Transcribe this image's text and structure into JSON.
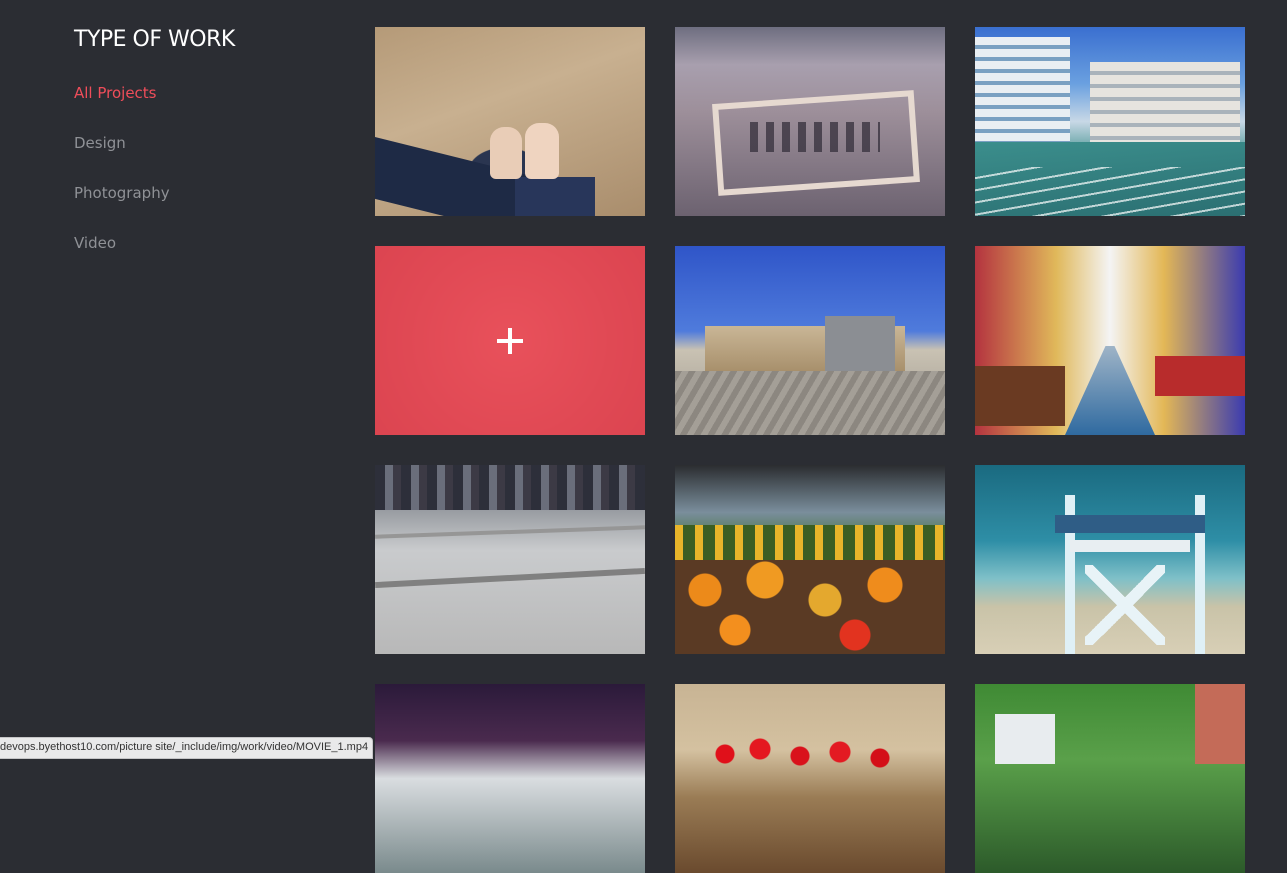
{
  "sidebar": {
    "title": "TYPE OF WORK",
    "filters": [
      {
        "label": "All Projects",
        "active": true
      },
      {
        "label": "Design",
        "active": false
      },
      {
        "label": "Photography",
        "active": false
      },
      {
        "label": "Video",
        "active": false
      }
    ]
  },
  "colors": {
    "background": "#2b2d33",
    "accent": "#ef4d5a",
    "overlay": "#e64854",
    "muted_text": "#8f9196"
  },
  "portfolio": {
    "hovered_item_index": 3,
    "hover_icon": "plus-icon",
    "items": [
      {
        "subject": "feet-on-sand"
      },
      {
        "subject": "writing-in-sand"
      },
      {
        "subject": "city-boulevard"
      },
      {
        "subject": "hovered-item"
      },
      {
        "subject": "plaza-buildings"
      },
      {
        "subject": "colorful-street"
      },
      {
        "subject": "crowded-walkway"
      },
      {
        "subject": "pumpkin-cart"
      },
      {
        "subject": "lifeguard-tower"
      },
      {
        "subject": "pier-view"
      },
      {
        "subject": "red-flowers"
      },
      {
        "subject": "garden-house"
      }
    ]
  },
  "status_bar": {
    "url": "devops.byethost10.com/picture site/_include/img/work/video/MOVIE_1.mp4"
  }
}
